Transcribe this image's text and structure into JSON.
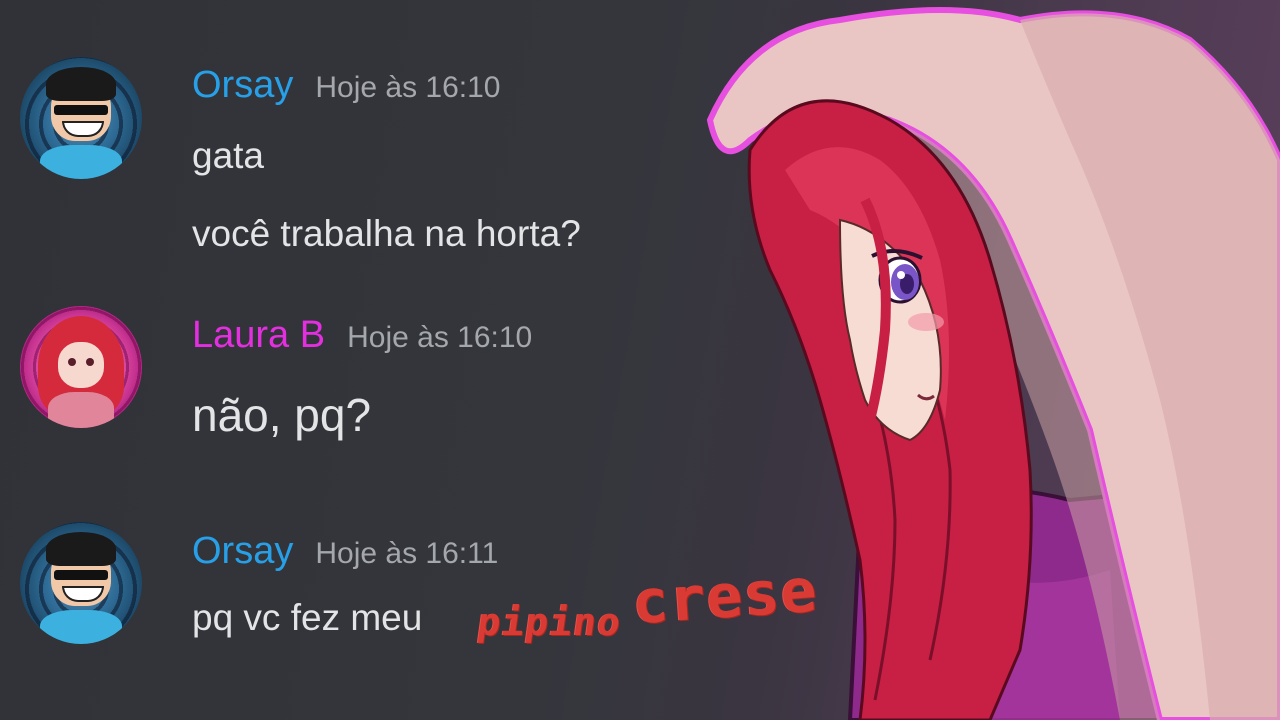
{
  "messages": [
    {
      "username": "Orsay",
      "username_color": "#27a0e8",
      "timestamp": "Hoje às 16:10",
      "lines": [
        "gata",
        "você trabalha na horta?"
      ]
    },
    {
      "username": "Laura B",
      "username_color": "#e42fe0",
      "timestamp": "Hoje às 16:10",
      "lines": [
        "não, pq?"
      ]
    },
    {
      "username": "Orsay",
      "username_color": "#27a0e8",
      "timestamp": "Hoje às 16:11",
      "lines": [
        "pq vc fez meu"
      ],
      "overlay_text": [
        "pipino",
        "crese"
      ]
    }
  ],
  "colors": {
    "background": "#33353b",
    "message_text": "#e3e4e6",
    "timestamp": "#a4a7ac",
    "overlay_text": "#d93a33",
    "art_outline": "#e64fe0"
  },
  "icons": [
    "orsay-avatar",
    "laura-avatar",
    "anime-girl-illustration"
  ]
}
